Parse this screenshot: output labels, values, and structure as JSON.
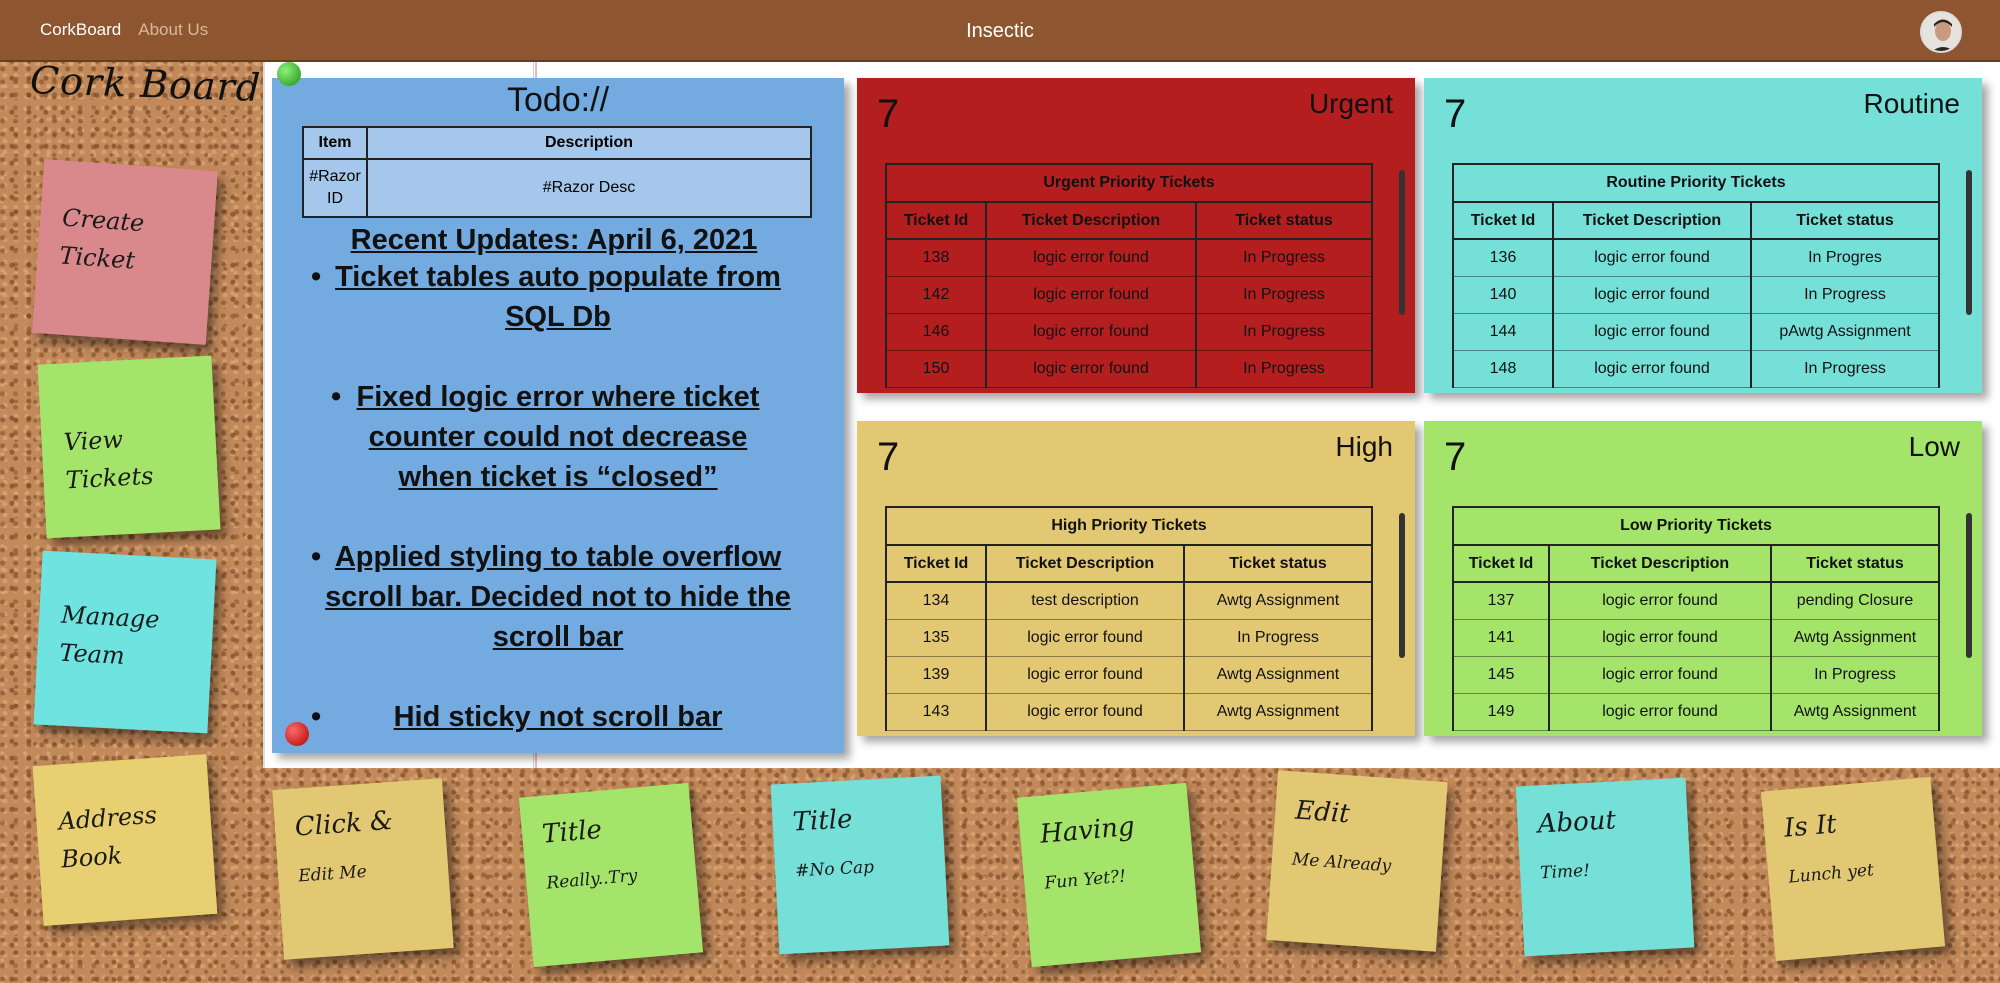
{
  "nav": {
    "brand": "CorkBoard",
    "about": "About Us",
    "title": "Insectic"
  },
  "board_title": "Cork Board",
  "side_notes": [
    {
      "label": "Create Ticket",
      "color": "#d9888c"
    },
    {
      "label": "View Tickets",
      "color": "#a4e46a"
    },
    {
      "label": "Manage Team",
      "color": "#6fe3e0"
    },
    {
      "label": "Address Book",
      "color": "#e8cf72"
    }
  ],
  "todo": {
    "title": "Todo://",
    "table": {
      "headers": [
        "Item",
        "Description"
      ],
      "row": [
        "#Razor ID",
        "#Razor Desc"
      ]
    },
    "updates_heading": "Recent Updates: April 6, 2021",
    "updates": [
      "Ticket tables auto populate from SQL Db",
      "Fixed logic error where ticket counter could not decrease when ticket is “closed”",
      "Applied styling to table overflow scroll bar. Decided not to hide the scroll bar",
      "Hid sticky not scroll bar"
    ]
  },
  "columns": [
    "Ticket Id",
    "Ticket Description",
    "Ticket status"
  ],
  "cards": {
    "urgent": {
      "count": "7",
      "name": "Urgent",
      "caption": "Urgent Priority Tickets",
      "color": "#b51e1f",
      "rows": [
        [
          "138",
          "logic error found",
          "In Progress"
        ],
        [
          "142",
          "logic error found",
          "In Progress"
        ],
        [
          "146",
          "logic error found",
          "In Progress"
        ],
        [
          "150",
          "logic error found",
          "In Progress"
        ]
      ]
    },
    "routine": {
      "count": "7",
      "name": "Routine",
      "caption": "Routine Priority Tickets",
      "color": "#74e0d8",
      "rows": [
        [
          "136",
          "logic error found",
          "In Progres"
        ],
        [
          "140",
          "logic error found",
          "In Progress"
        ],
        [
          "144",
          "logic error found",
          "pAwtg Assignment"
        ],
        [
          "148",
          "logic error found",
          "In Progress"
        ]
      ]
    },
    "high": {
      "count": "7",
      "name": "High",
      "caption": "High Priority Tickets",
      "color": "#e2c873",
      "rows": [
        [
          "134",
          "test description",
          "Awtg Assignment"
        ],
        [
          "135",
          "logic error found",
          "In Progress"
        ],
        [
          "139",
          "logic error found",
          "Awtg Assignment"
        ],
        [
          "143",
          "logic error found",
          "Awtg Assignment"
        ]
      ]
    },
    "low": {
      "count": "7",
      "name": "Low",
      "caption": "Low Priority Tickets",
      "color": "#a4e46a",
      "rows": [
        [
          "137",
          "logic error found",
          "pending Closure"
        ],
        [
          "141",
          "logic error found",
          "Awtg Assignment"
        ],
        [
          "145",
          "logic error found",
          "In Progress"
        ],
        [
          "149",
          "logic error found",
          "Awtg Assignment"
        ]
      ]
    }
  },
  "bottom_notes": [
    {
      "title": "Click &",
      "sub": "Edit Me",
      "color": "#e2c873"
    },
    {
      "title": "Title",
      "sub": "Really..Try",
      "color": "#a4e46a"
    },
    {
      "title": "Title",
      "sub": "#No Cap",
      "color": "#74e0d8"
    },
    {
      "title": "Having",
      "sub": "Fun Yet?!",
      "color": "#a4e46a"
    },
    {
      "title": "Edit",
      "sub": "Me Already",
      "color": "#e2c873"
    },
    {
      "title": "About",
      "sub": "Time!",
      "color": "#74e0d8"
    },
    {
      "title": "Is It",
      "sub": "Lunch yet",
      "color": "#e2c873"
    }
  ]
}
